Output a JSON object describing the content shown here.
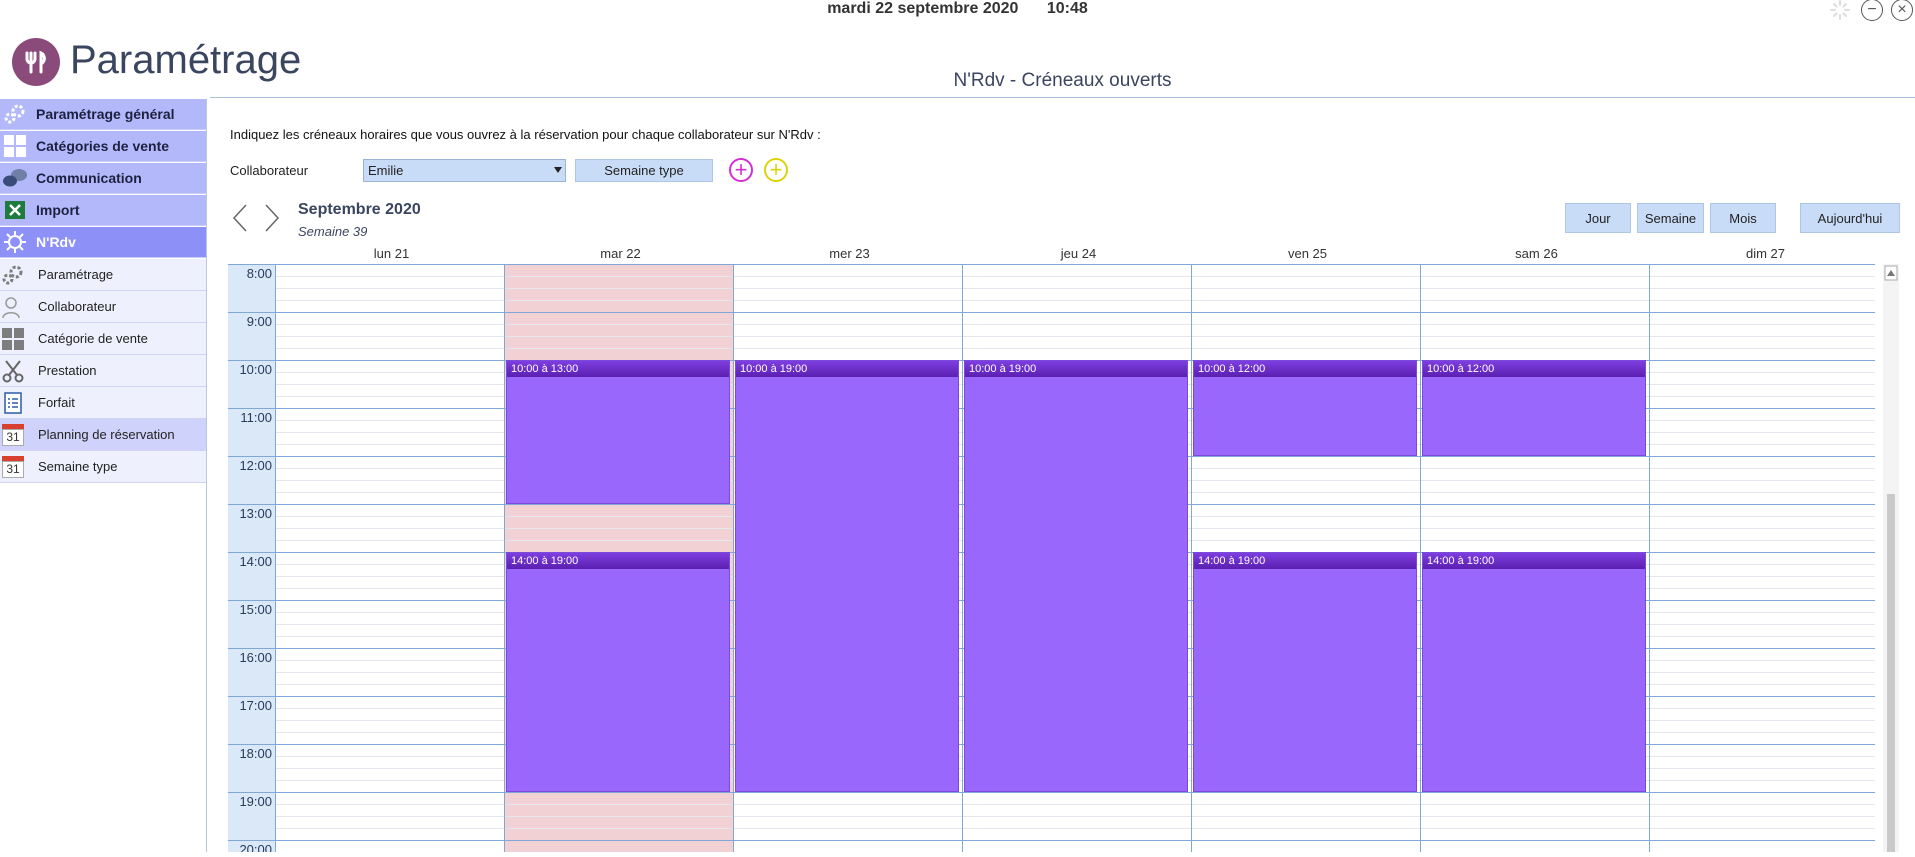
{
  "topbar": {
    "date": "mardi 22 septembre 2020",
    "time": "10:48"
  },
  "app": {
    "title": "Paramétrage",
    "logo_icon": "cutlery-icon"
  },
  "page": {
    "title": "N'Rdv - Créneaux ouverts"
  },
  "sidebar": {
    "main_items": [
      {
        "label": "Paramétrage général",
        "icon": "gears-icon"
      },
      {
        "label": "Catégories de vente",
        "icon": "grid-icon"
      },
      {
        "label": "Communication",
        "icon": "chat-bubbles-icon"
      },
      {
        "label": "Import",
        "icon": "excel-icon"
      },
      {
        "label": "N'Rdv",
        "icon": "nrdv-icon",
        "active": true
      }
    ],
    "sub_items": [
      {
        "label": "Paramétrage",
        "icon": "gears-icon"
      },
      {
        "label": "Collaborateur",
        "icon": "person-icon"
      },
      {
        "label": "Catégorie de vente",
        "icon": "grid-icon"
      },
      {
        "label": "Prestation",
        "icon": "scissors-icon"
      },
      {
        "label": "Forfait",
        "icon": "checklist-icon"
      },
      {
        "label": "Planning de réservation",
        "icon": "calendar-icon",
        "active": true
      },
      {
        "label": "Semaine type",
        "icon": "calendar-icon"
      }
    ],
    "calendar_icon_text": "31"
  },
  "content": {
    "instructions": "Indiquez les créneaux horaires que vous ouvrez à la réservation pour chaque collaborateur sur N'Rdv :",
    "collaborateur_label": "Collaborateur",
    "collaborateur_value": "Emilie",
    "semaine_type_btn": "Semaine type"
  },
  "calendar": {
    "month_title": "Septembre 2020",
    "week_label": "Semaine 39",
    "view_buttons": {
      "day": "Jour",
      "week": "Semaine",
      "month": "Mois",
      "today": "Aujourd'hui"
    },
    "days": [
      "lun 21",
      "mar 22",
      "mer 23",
      "jeu 24",
      "ven 25",
      "sam 26",
      "dim 27"
    ],
    "hours": [
      "8:00",
      "9:00",
      "10:00",
      "11:00",
      "12:00",
      "13:00",
      "14:00",
      "15:00",
      "16:00",
      "17:00",
      "18:00",
      "19:00",
      "20:00"
    ],
    "today_index": 1,
    "events": [
      {
        "day": 1,
        "label": "10:00 à 13:00"
      },
      {
        "day": 1,
        "label": "14:00 à 19:00"
      },
      {
        "day": 2,
        "label": "10:00 à 19:00"
      },
      {
        "day": 3,
        "label": "10:00 à 19:00"
      },
      {
        "day": 4,
        "label": "10:00 à 12:00"
      },
      {
        "day": 4,
        "label": "14:00 à 19:00"
      },
      {
        "day": 5,
        "label": "10:00 à 12:00"
      },
      {
        "day": 5,
        "label": "14:00 à 19:00"
      }
    ],
    "colors": {
      "event": "#9a67fd",
      "event_header": "#5a1fb0",
      "today_bg": "#f1d1d3",
      "time_col": "#dbe8f8"
    }
  }
}
